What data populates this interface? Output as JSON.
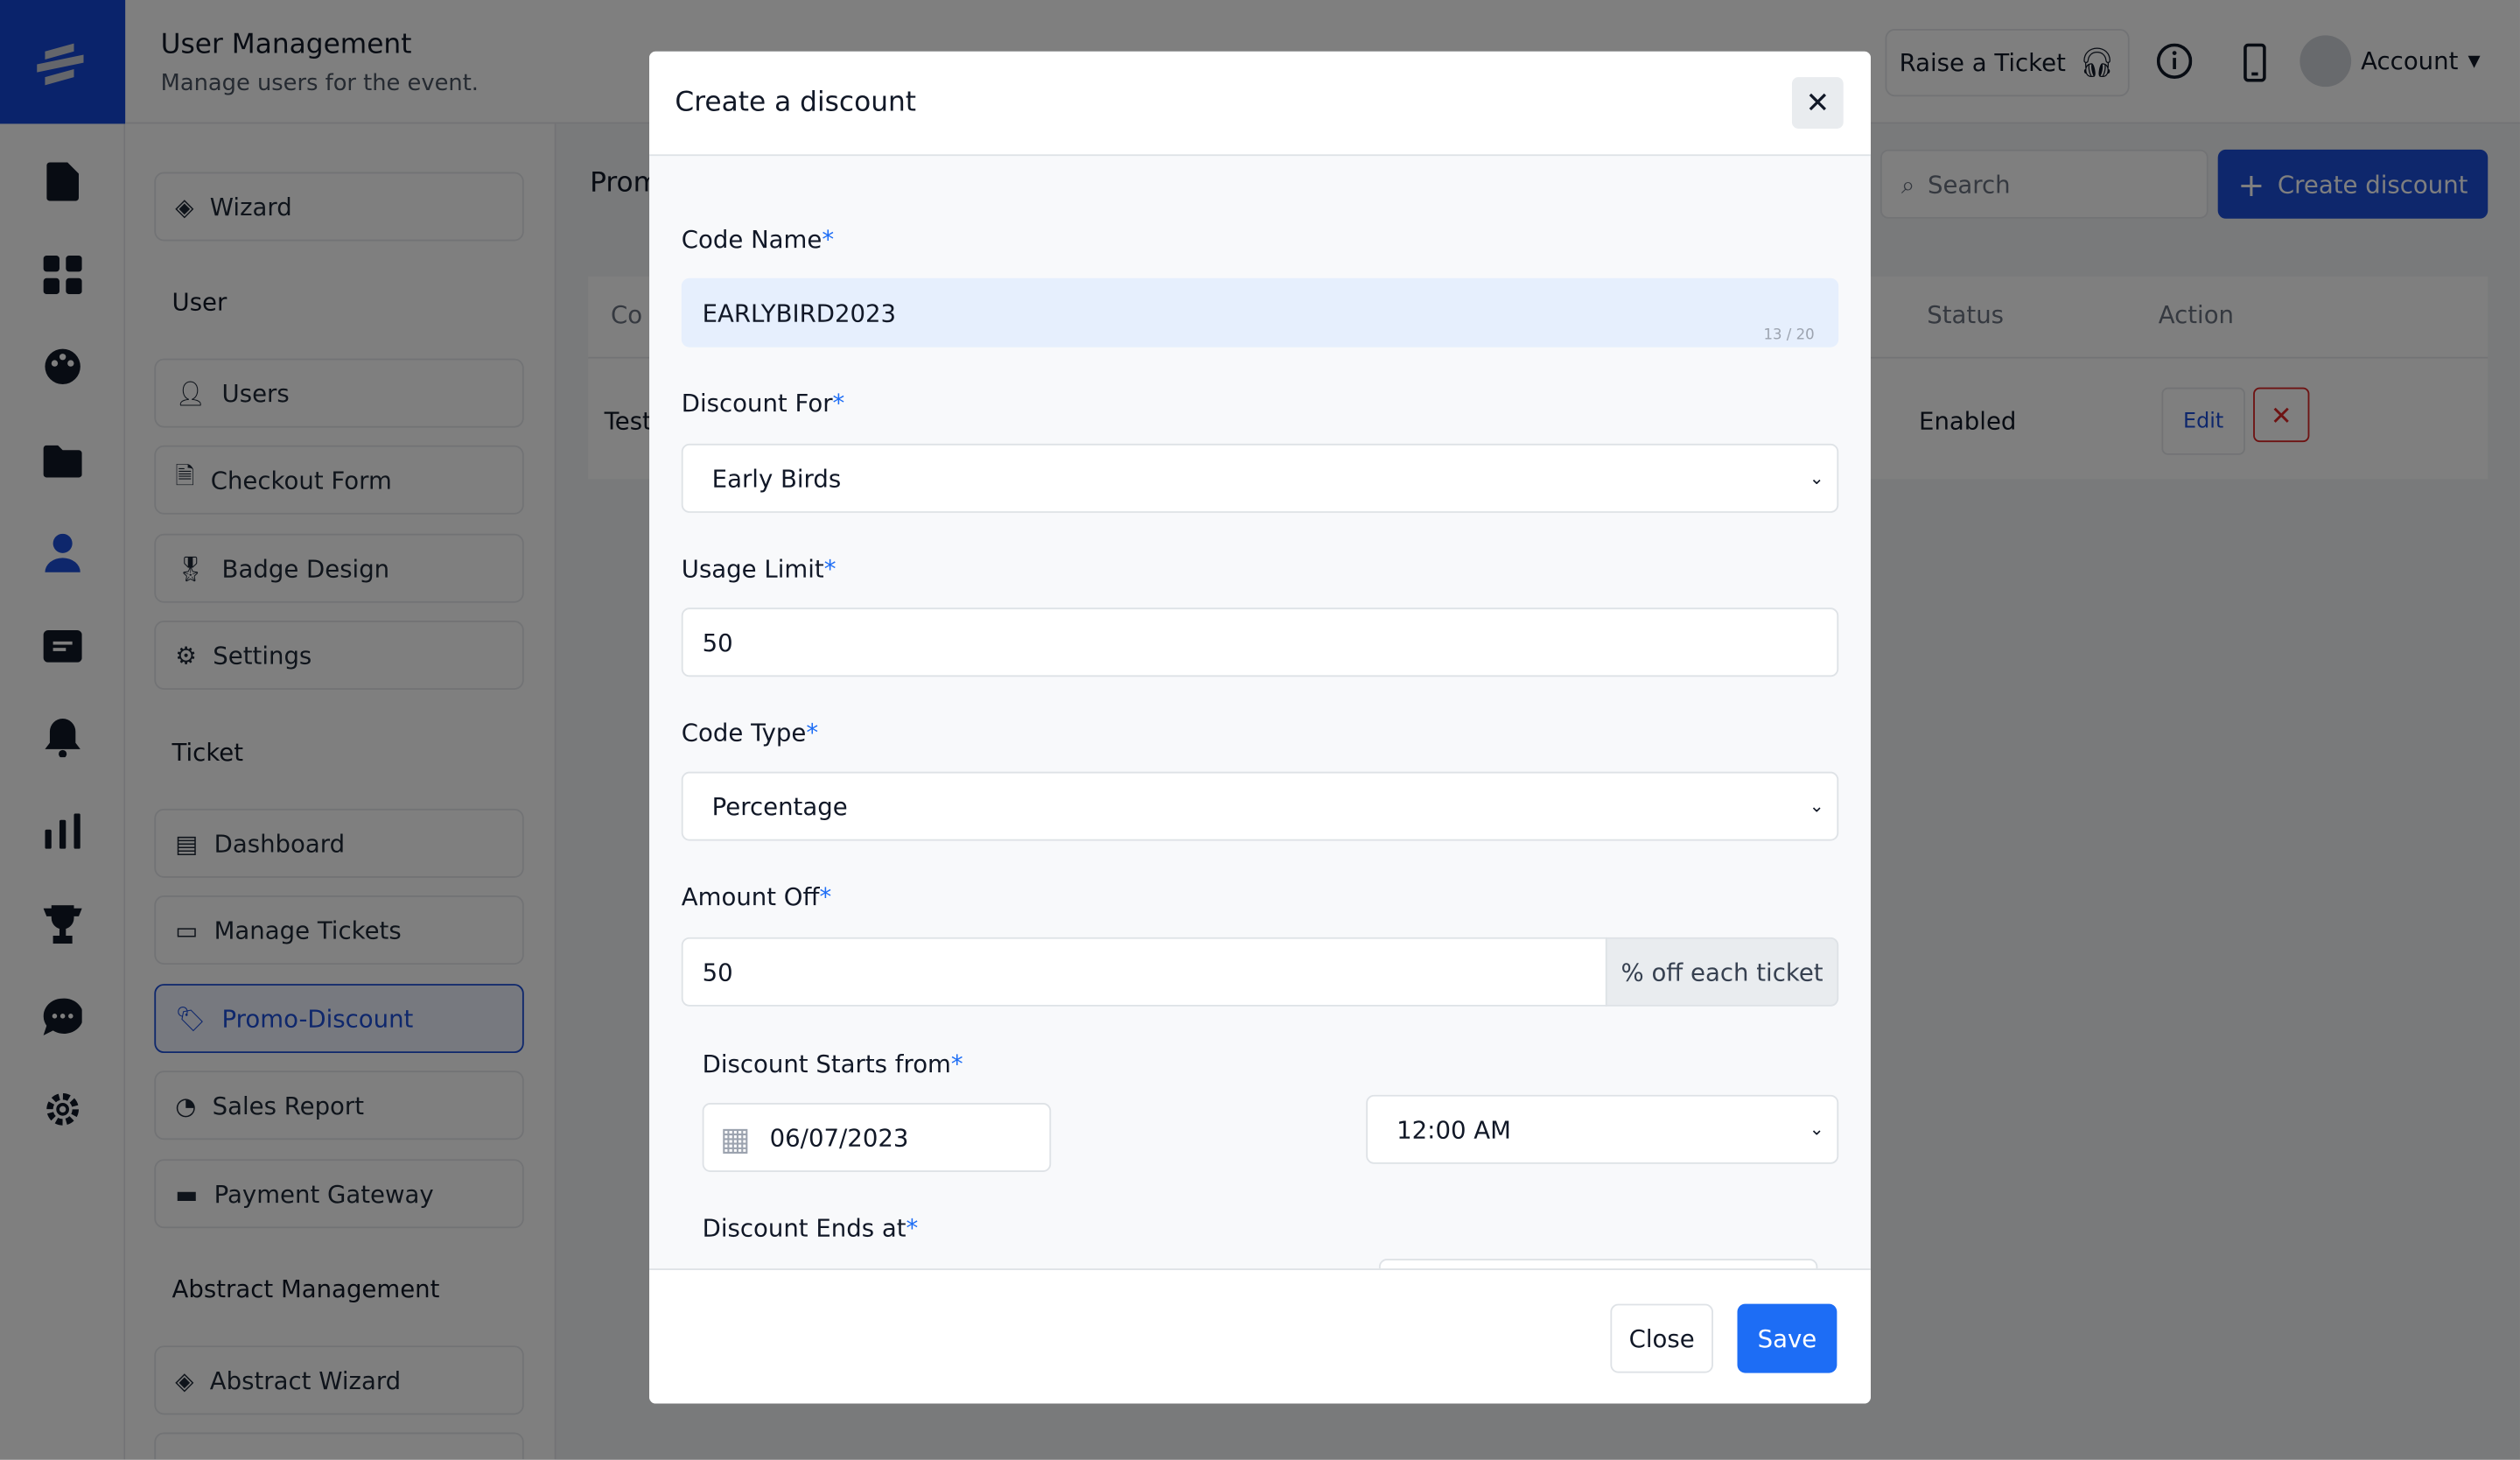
{
  "header": {
    "title": "User Management",
    "subtitle": "Manage users for the event.",
    "raise_ticket": "Raise a Ticket",
    "account": "Account"
  },
  "rail": {
    "icons": [
      "file-icon",
      "grid-icon",
      "palette-icon",
      "folder-icon",
      "user-icon",
      "message-square-icon",
      "bell-icon",
      "bar-chart-icon",
      "trophy-icon",
      "chat-icon",
      "gear-icon"
    ]
  },
  "sidebar": {
    "wizard": "Wizard",
    "section_user": "User",
    "users": "Users",
    "checkout_form": "Checkout Form",
    "badge_design": "Badge Design",
    "settings": "Settings",
    "section_ticket": "Ticket",
    "dashboard": "Dashboard",
    "manage_tickets": "Manage Tickets",
    "promo_discount": "Promo-Discount",
    "sales_report": "Sales Report",
    "payment_gateway": "Payment Gateway",
    "section_abstract": "Abstract Management",
    "abstract_wizard": "Abstract Wizard"
  },
  "content": {
    "title": "Prom",
    "search_placeholder": "Search",
    "create_discount": "Create discount",
    "columns": {
      "code": "Co",
      "status": "Status",
      "action": "Action"
    },
    "row": {
      "code": "Test",
      "status": "Enabled",
      "edit": "Edit"
    }
  },
  "modal": {
    "title": "Create a discount",
    "code_name": {
      "label": "Code Name",
      "value": "EARLYBIRD2023",
      "counter": "13 / 20"
    },
    "discount_for": {
      "label": "Discount For",
      "value": "Early Birds"
    },
    "usage_limit": {
      "label": "Usage Limit",
      "value": "50"
    },
    "code_type": {
      "label": "Code Type",
      "value": "Percentage"
    },
    "amount_off": {
      "label": "Amount Off",
      "value": "50",
      "suffix": "% off each ticket"
    },
    "starts": {
      "label": "Discount Starts from",
      "date": "06/07/2023",
      "time": "12:00 AM"
    },
    "ends": {
      "label": "Discount Ends at"
    },
    "required_mark": "*",
    "close": "Close",
    "save": "Save"
  },
  "colors": {
    "primary": "#1d4ed8",
    "save": "#1d6df5",
    "danger": "#dc2626"
  }
}
